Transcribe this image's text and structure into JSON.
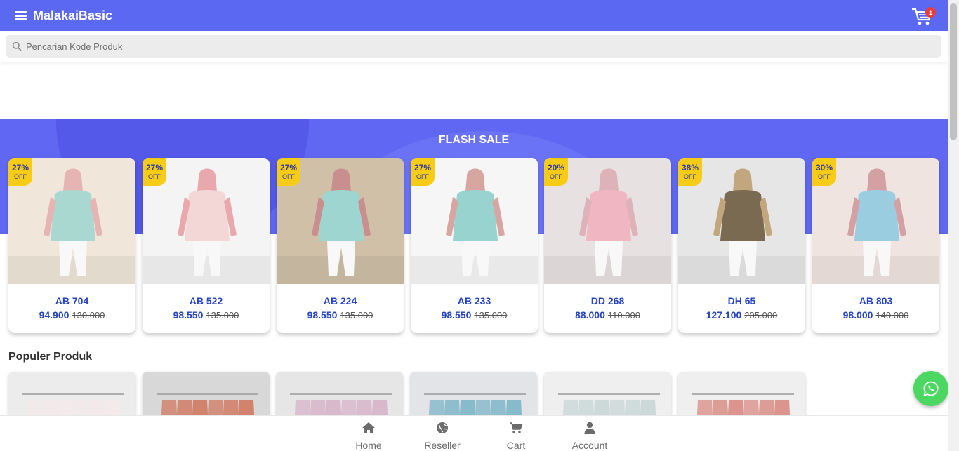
{
  "header": {
    "brand": "MalakaiBasic",
    "cart_count": "1"
  },
  "search": {
    "placeholder": "Pencarian Kode Produk"
  },
  "flash_sale": {
    "title": "FLASH SALE",
    "off_label": "OFF",
    "products": [
      {
        "discount": "27%",
        "code": "AB 704",
        "price": "94.900",
        "old_price": "130.000",
        "colors": [
          "#f0e6da",
          "#a8d8d0",
          "#e7b4b4"
        ]
      },
      {
        "discount": "27%",
        "code": "AB 522",
        "price": "98.550",
        "old_price": "135.000",
        "colors": [
          "#f4f4f4",
          "#f2d7d6",
          "#e9a8ab"
        ]
      },
      {
        "discount": "27%",
        "code": "AB 224",
        "price": "98.550",
        "old_price": "135.000",
        "colors": [
          "#cfc0a7",
          "#9fd5d1",
          "#c98e8e"
        ]
      },
      {
        "discount": "27%",
        "code": "AB 233",
        "price": "98.550",
        "old_price": "135.000",
        "colors": [
          "#f6f6f6",
          "#98d3cf",
          "#d7a6a0"
        ]
      },
      {
        "discount": "20%",
        "code": "DD 268",
        "price": "88.000",
        "old_price": "110.000",
        "colors": [
          "#e7e1e1",
          "#f0b6c1",
          "#ddb2b8"
        ]
      },
      {
        "discount": "38%",
        "code": "DH 65",
        "price": "127.100",
        "old_price": "205.000",
        "colors": [
          "#e6e6e6",
          "#7a6a52",
          "#c2a77e"
        ]
      },
      {
        "discount": "30%",
        "code": "AB 803",
        "price": "98.000",
        "old_price": "140.000",
        "colors": [
          "#f0e4e0",
          "#9bcde0",
          "#d3a0a4"
        ]
      }
    ]
  },
  "popular": {
    "title": "Populer Produk",
    "items": [
      {
        "colors": [
          "#ececec",
          "#f4e8ea"
        ]
      },
      {
        "colors": [
          "#d8d8d8",
          "#d07a62"
        ]
      },
      {
        "colors": [
          "#e6e6e6",
          "#d6b3c8"
        ]
      },
      {
        "colors": [
          "#e2e4e8",
          "#7db6c8"
        ]
      },
      {
        "colors": [
          "#efefef",
          "#c9d6d6"
        ]
      },
      {
        "colors": [
          "#efefef",
          "#d98b84"
        ]
      }
    ]
  },
  "bottom_nav": {
    "items": [
      {
        "label": "Home",
        "icon": "home-icon"
      },
      {
        "label": "Reseller",
        "icon": "globe-icon"
      },
      {
        "label": "Cart",
        "icon": "cart-icon"
      },
      {
        "label": "Account",
        "icon": "user-icon"
      }
    ]
  },
  "colors": {
    "primary": "#5b68f1",
    "accent": "#2543c3",
    "badge": "#f7cc17",
    "whatsapp": "#4cd763"
  }
}
